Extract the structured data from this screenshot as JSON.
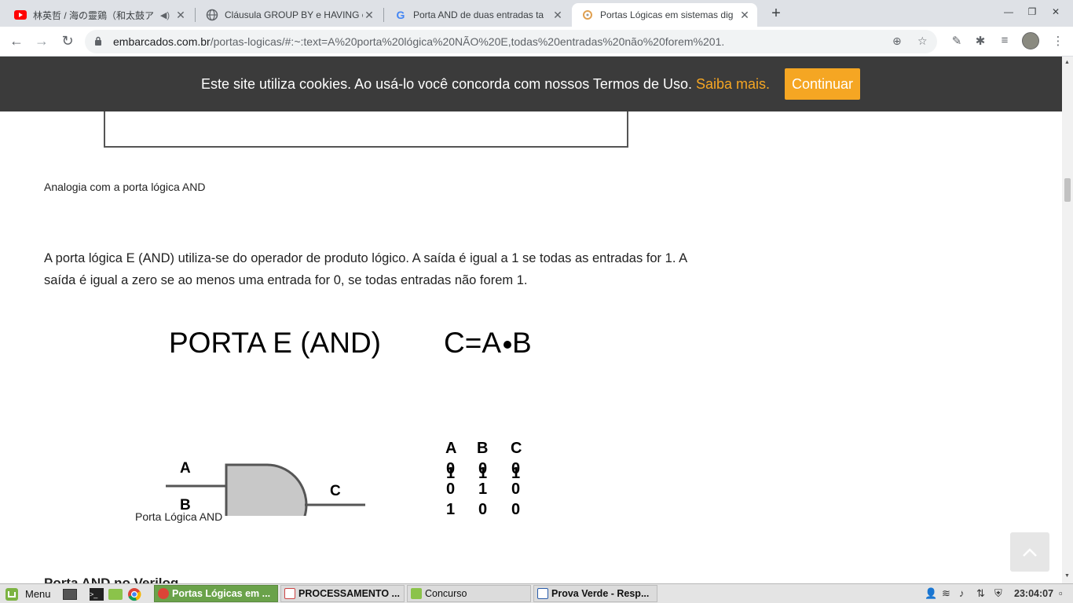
{
  "tabs": [
    {
      "title": "林英哲 / 海の靈鶏（和太鼓ア",
      "icon": "youtube-icon"
    },
    {
      "title": "Cláusula GROUP BY e HAVING c",
      "icon": "globe-icon"
    },
    {
      "title": "Porta AND de duas entradas ta",
      "icon": "google-icon"
    },
    {
      "title": "Portas Lógicas em sistemas dig",
      "icon": "site-icon"
    }
  ],
  "address": {
    "domain": "embarcados.com.br",
    "path": "/portas-logicas/#:~:text=A%20porta%20lógica%20NÃO%20E,todas%20entradas%20não%20forem%201."
  },
  "cookie": {
    "message": "Este site utiliza cookies. Ao usá-lo você concorda com nossos Termos de Uso.",
    "link": "Saiba mais.",
    "button": "Continuar"
  },
  "article": {
    "caption_prev": "Analogia com a porta lógica AND",
    "paragraph": "A porta lógica E (AND) utiliza-se do operador de produto lógico. A saída é igual a 1 se todas as entradas for 1. A saída é igual a zero se ao menos uma entrada for 0, se todas entradas não forem 1.",
    "figure": {
      "title": "PORTA E (AND)",
      "equation_left": "C=A",
      "equation_right": "B",
      "label_a": "A",
      "label_b": "B",
      "label_c": "C",
      "truth_headers": [
        "A",
        "B",
        "C"
      ],
      "truth_rows": [
        [
          "0",
          "0",
          "0"
        ],
        [
          "0",
          "1",
          "0"
        ],
        [
          "1",
          "0",
          "0"
        ],
        [
          "1",
          "1",
          "1"
        ]
      ]
    },
    "caption_fig": "Porta Lógica AND",
    "next_heading": "Porta AND no Verilog"
  },
  "taskbar": {
    "menu": "Menu",
    "windows": [
      {
        "title": "Portas Lógicas em ...",
        "active": true
      },
      {
        "title": "PROCESSAMENTO ...",
        "active": false
      },
      {
        "title": "Concurso",
        "active": false
      },
      {
        "title": "Prova Verde - Resp...",
        "active": false
      }
    ],
    "clock": "23:04:07"
  },
  "colors": {
    "accent": "#f5a623",
    "cookie_bg": "#3b3b3b",
    "taskbar_active": "#6aa24a"
  }
}
